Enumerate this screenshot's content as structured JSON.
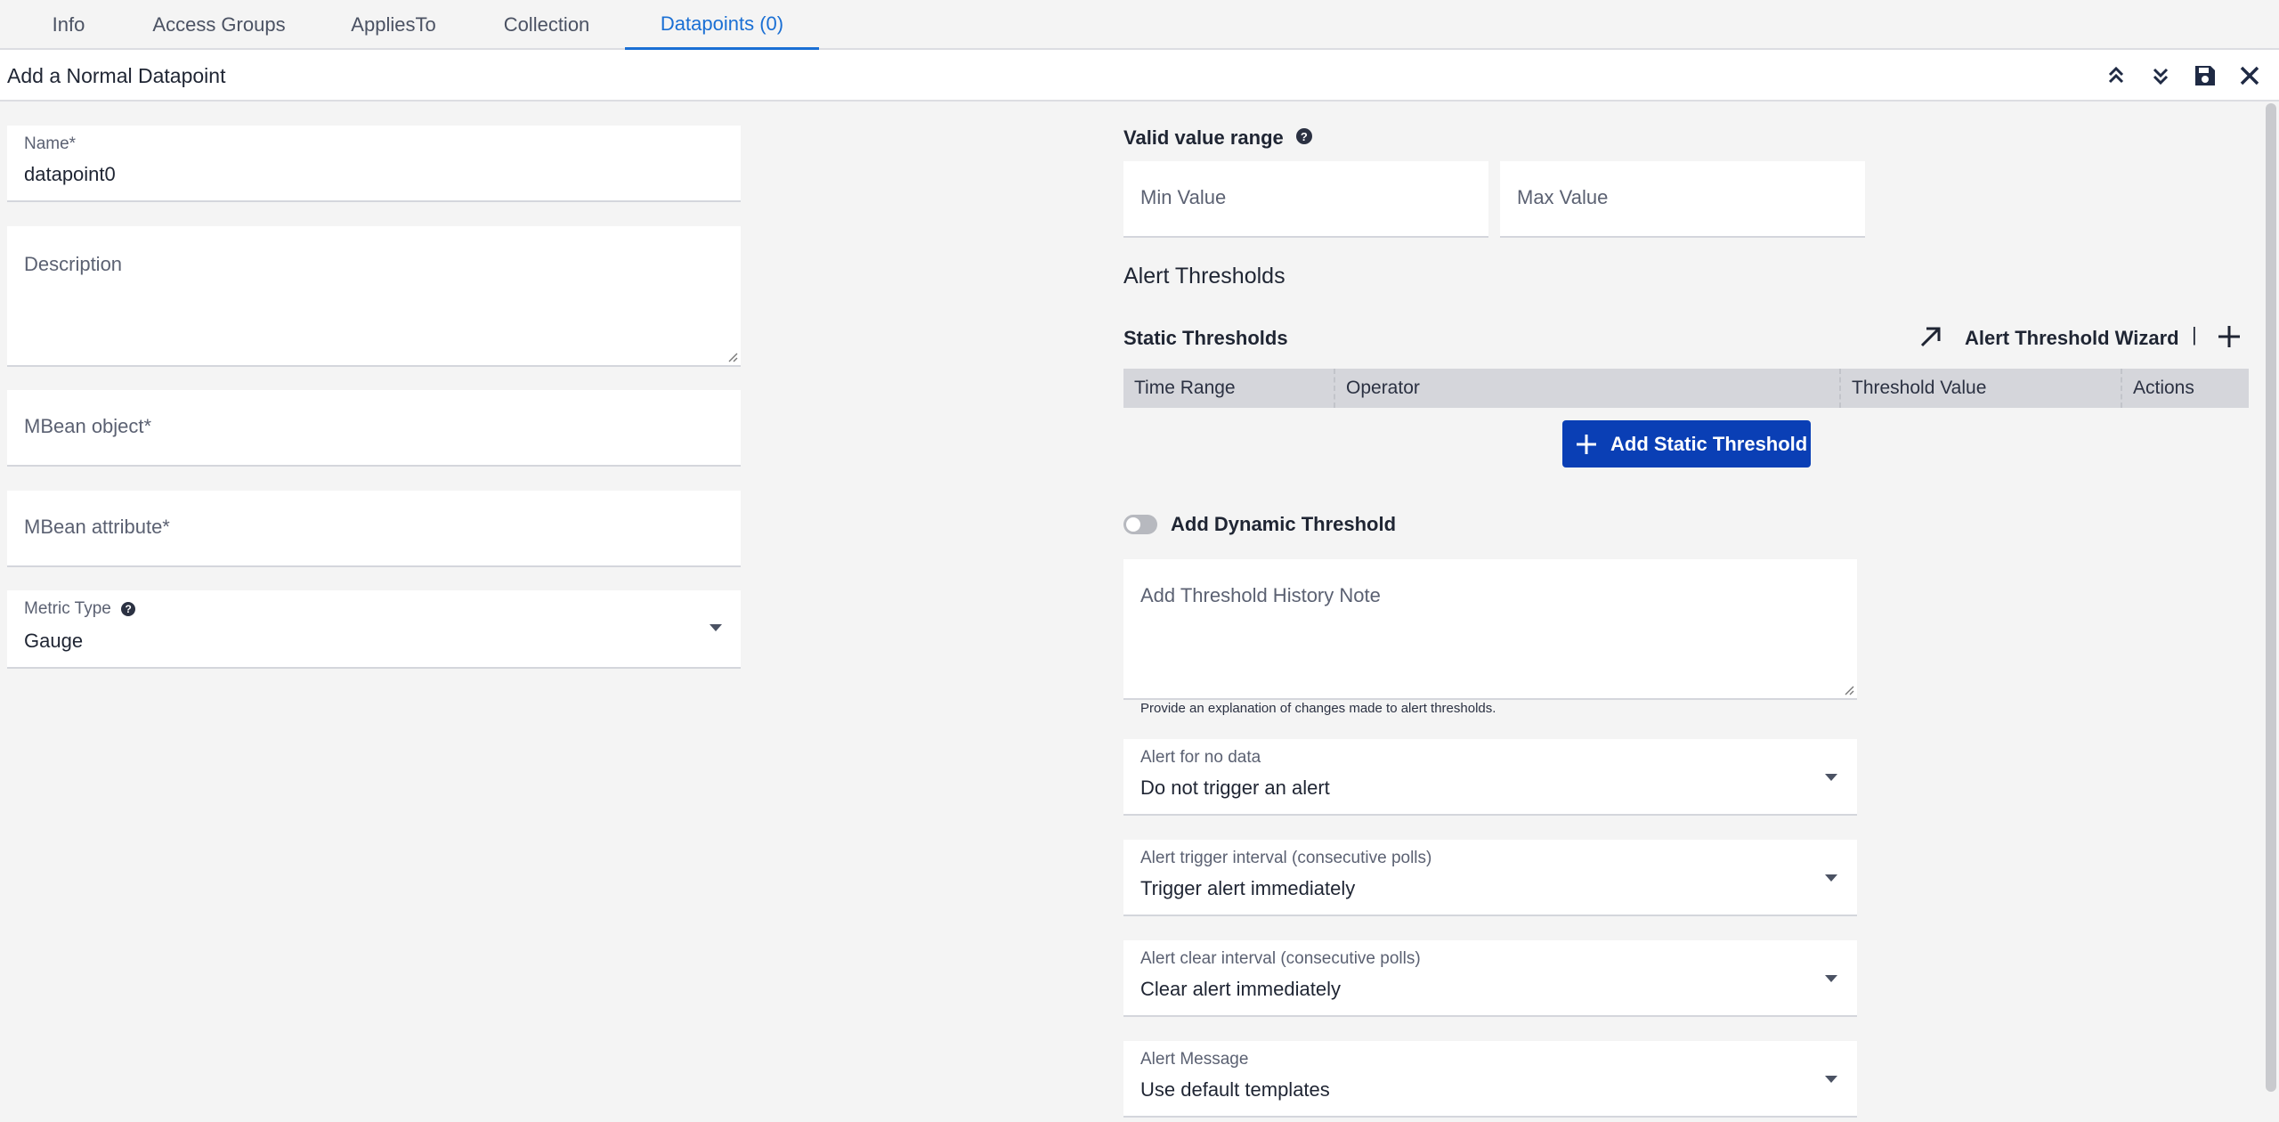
{
  "tabs": [
    {
      "label": "Info"
    },
    {
      "label": "Access Groups"
    },
    {
      "label": "AppliesTo"
    },
    {
      "label": "Collection"
    },
    {
      "label": "Datapoints (0)",
      "active": true
    }
  ],
  "header": {
    "title": "Add a Normal Datapoint",
    "icons": [
      "collapse-all-icon",
      "expand-all-icon",
      "save-icon",
      "close-icon"
    ]
  },
  "left": {
    "name": {
      "label": "Name*",
      "value": "datapoint0"
    },
    "description": {
      "placeholder": "Description"
    },
    "mbean_object": {
      "placeholder": "MBean object*"
    },
    "mbean_attribute": {
      "placeholder": "MBean attribute*"
    },
    "metric_type": {
      "label": "Metric Type",
      "value": "Gauge",
      "help": "?"
    }
  },
  "right": {
    "valid_range": {
      "label": "Valid value range",
      "help": "?",
      "min_placeholder": "Min Value",
      "max_placeholder": "Max Value"
    },
    "alert_thresholds_title": "Alert Thresholds",
    "static_thresholds": {
      "label": "Static Thresholds",
      "wizard_label": "Alert Threshold Wizard",
      "separator": "|",
      "columns": [
        "Time Range",
        "Operator",
        "Threshold Value",
        "Actions"
      ],
      "add_button": "Add Static Threshold"
    },
    "dynamic_threshold": {
      "label": "Add Dynamic Threshold",
      "enabled": false
    },
    "history_note": {
      "placeholder": "Add Threshold History Note",
      "help_text": "Provide an explanation of changes made to alert thresholds."
    },
    "alert_no_data": {
      "label": "Alert for no data",
      "value": "Do not trigger an alert"
    },
    "alert_trigger_interval": {
      "label": "Alert trigger interval (consecutive polls)",
      "value": "Trigger alert immediately"
    },
    "alert_clear_interval": {
      "label": "Alert clear interval (consecutive polls)",
      "value": "Clear alert immediately"
    },
    "alert_message": {
      "label": "Alert Message",
      "value": "Use default templates"
    }
  },
  "colors": {
    "accent": "#1a6fd4",
    "primary_button": "#0a3fb5",
    "page_bg": "#f4f4f4"
  }
}
